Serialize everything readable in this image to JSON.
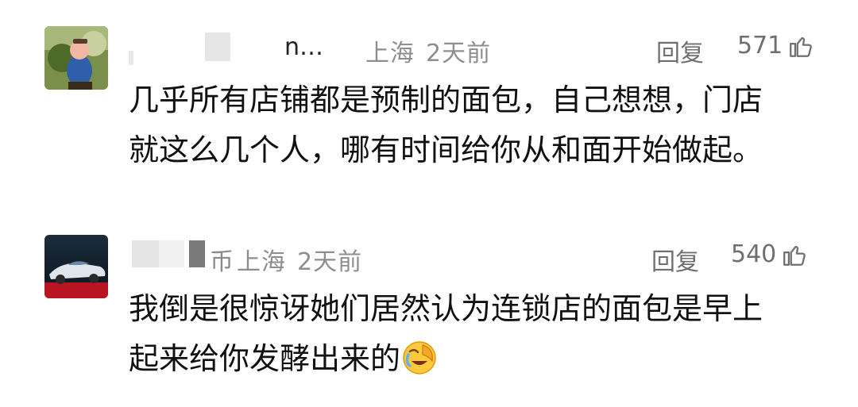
{
  "comments": [
    {
      "name_visible_tail": "n…",
      "location": "上海",
      "time": "2天前",
      "reply_label": "回复",
      "likes": "571",
      "lines": [
        "几乎所有店铺都是预制的面包，自己想想，门店",
        "就这么几个人，哪有时间给你从和面开始做起。"
      ],
      "avatar_icon": "cartoon-character-avatar"
    },
    {
      "name_visible_tail": "币",
      "location": "上海",
      "time": "2天前",
      "reply_label": "回复",
      "likes": "540",
      "lines": [
        "我倒是很惊讶她们居然认为连锁店的面包是早上",
        "起来给你发酵出来的"
      ],
      "emoji": "facepalm-laughing-emoji",
      "avatar_icon": "sports-car-avatar"
    }
  ],
  "colors": {
    "meta_gray": "#8e8e8e",
    "text": "#111111",
    "background": "#ffffff"
  }
}
